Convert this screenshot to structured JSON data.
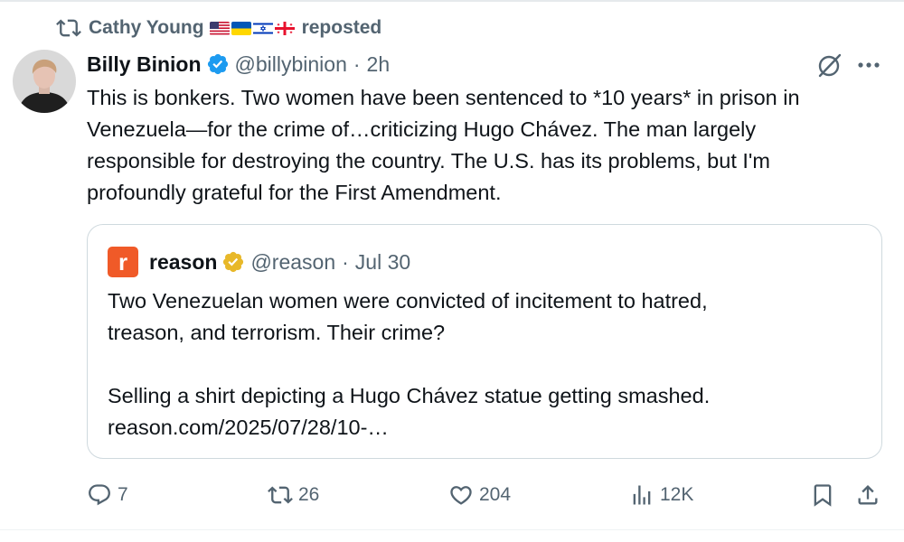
{
  "repost": {
    "user": "Cathy Young",
    "label": "reposted"
  },
  "tweet": {
    "name": "Billy Binion",
    "handle": "@billybinion",
    "separator": "·",
    "time": "2h",
    "text_lines": [
      "This is bonkers. Two women have been sentenced to *10 years* in prison in",
      "Venezuela—for the crime of…criticizing Hugo Chávez. The man largely",
      "responsible for destroying the country. The U.S. has its problems, but I'm",
      "profoundly grateful for the First Amendment."
    ]
  },
  "quote": {
    "logo_letter": "r",
    "name": "reason",
    "handle": "@reason",
    "separator": "·",
    "date": "Jul 30",
    "text_lines": [
      "Two Venezuelan women were convicted of incitement to hatred,",
      "treason, and terrorism. Their crime?",
      "",
      "Selling a shirt depicting a Hugo Chávez statue getting smashed.",
      "reason.com/2025/07/28/10-…"
    ]
  },
  "actions": {
    "replies": "7",
    "reposts": "26",
    "likes": "204",
    "views": "12K"
  },
  "icons": {
    "repost": "repost-icon",
    "verified": "verified-badge-icon",
    "grok": "grok-icon",
    "more": "more-icon",
    "reply": "reply-icon",
    "like": "heart-icon",
    "views": "views-icon",
    "bookmark": "bookmark-icon",
    "share": "share-icon"
  },
  "colors": {
    "blue_verified": "#1d9bf0",
    "gold_verified": "#e8b829",
    "reason_brand": "#f05a28",
    "secondary_text": "#536471"
  }
}
